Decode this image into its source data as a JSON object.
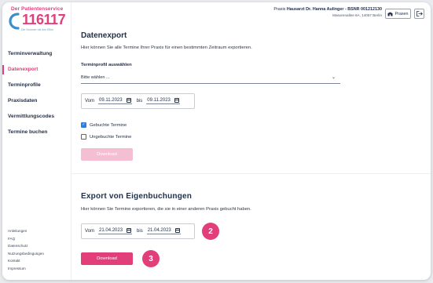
{
  "logo": {
    "tagline_top": "Der Patientenservice",
    "number": "116117",
    "tagline_bottom": "Die Nummer mit den Elfen"
  },
  "sidebar": {
    "items": [
      {
        "label": "Terminverwaltung",
        "active": false
      },
      {
        "label": "Datenexport",
        "active": true
      },
      {
        "label": "Terminprofile",
        "active": false
      },
      {
        "label": "Praxisdaten",
        "active": false
      },
      {
        "label": "Vermittlungscodes",
        "active": false
      },
      {
        "label": "Termine buchen",
        "active": false
      }
    ],
    "footer": [
      "Anleitungen",
      "FAQ",
      "Datenschutz",
      "Nutzungsbedingungen",
      "Kontakt",
      "Impressum"
    ]
  },
  "header": {
    "praxis_label": "Praxis",
    "praxis_name": "Hausarzt Dr. Hanna Aulinger - BSNR 001212130",
    "address": "Masurenallee 6A, 14057 Berlin",
    "praxen_button": "Praxen"
  },
  "export": {
    "title": "Datenexport",
    "description": "Hier können Sie alle Termine Ihrer Praxis für einen bestimmten Zeitraum exportieren.",
    "profile_label": "Terminprofil auswählen",
    "profile_placeholder": "Bitte wählen ...",
    "from_label": "Vom",
    "from_date": "09.11.2023",
    "to_label": "bis",
    "to_date": "09.11.2023",
    "checkbox_booked": "Gebuchte Termine",
    "checkbox_booked_checked": true,
    "checkbox_unbooked": "Ungebuchte Termine",
    "checkbox_unbooked_checked": false,
    "download_label": "Download"
  },
  "own_bookings": {
    "title": "Export von Eigenbuchungen",
    "description": "Hier können Sie Termine exportieren, die sie in einer anderen Praxis gebucht haben.",
    "from_label": "Vom",
    "from_date": "21.04.2023",
    "to_label": "bis",
    "to_date": "21.04.2023",
    "download_label": "Download"
  },
  "steps": {
    "step_a": "2",
    "step_b": "3"
  },
  "colors": {
    "accent": "#e23e79",
    "accent_disabled": "#f4bfd2",
    "checkbox": "#2e7de0",
    "text": "#22304a"
  }
}
